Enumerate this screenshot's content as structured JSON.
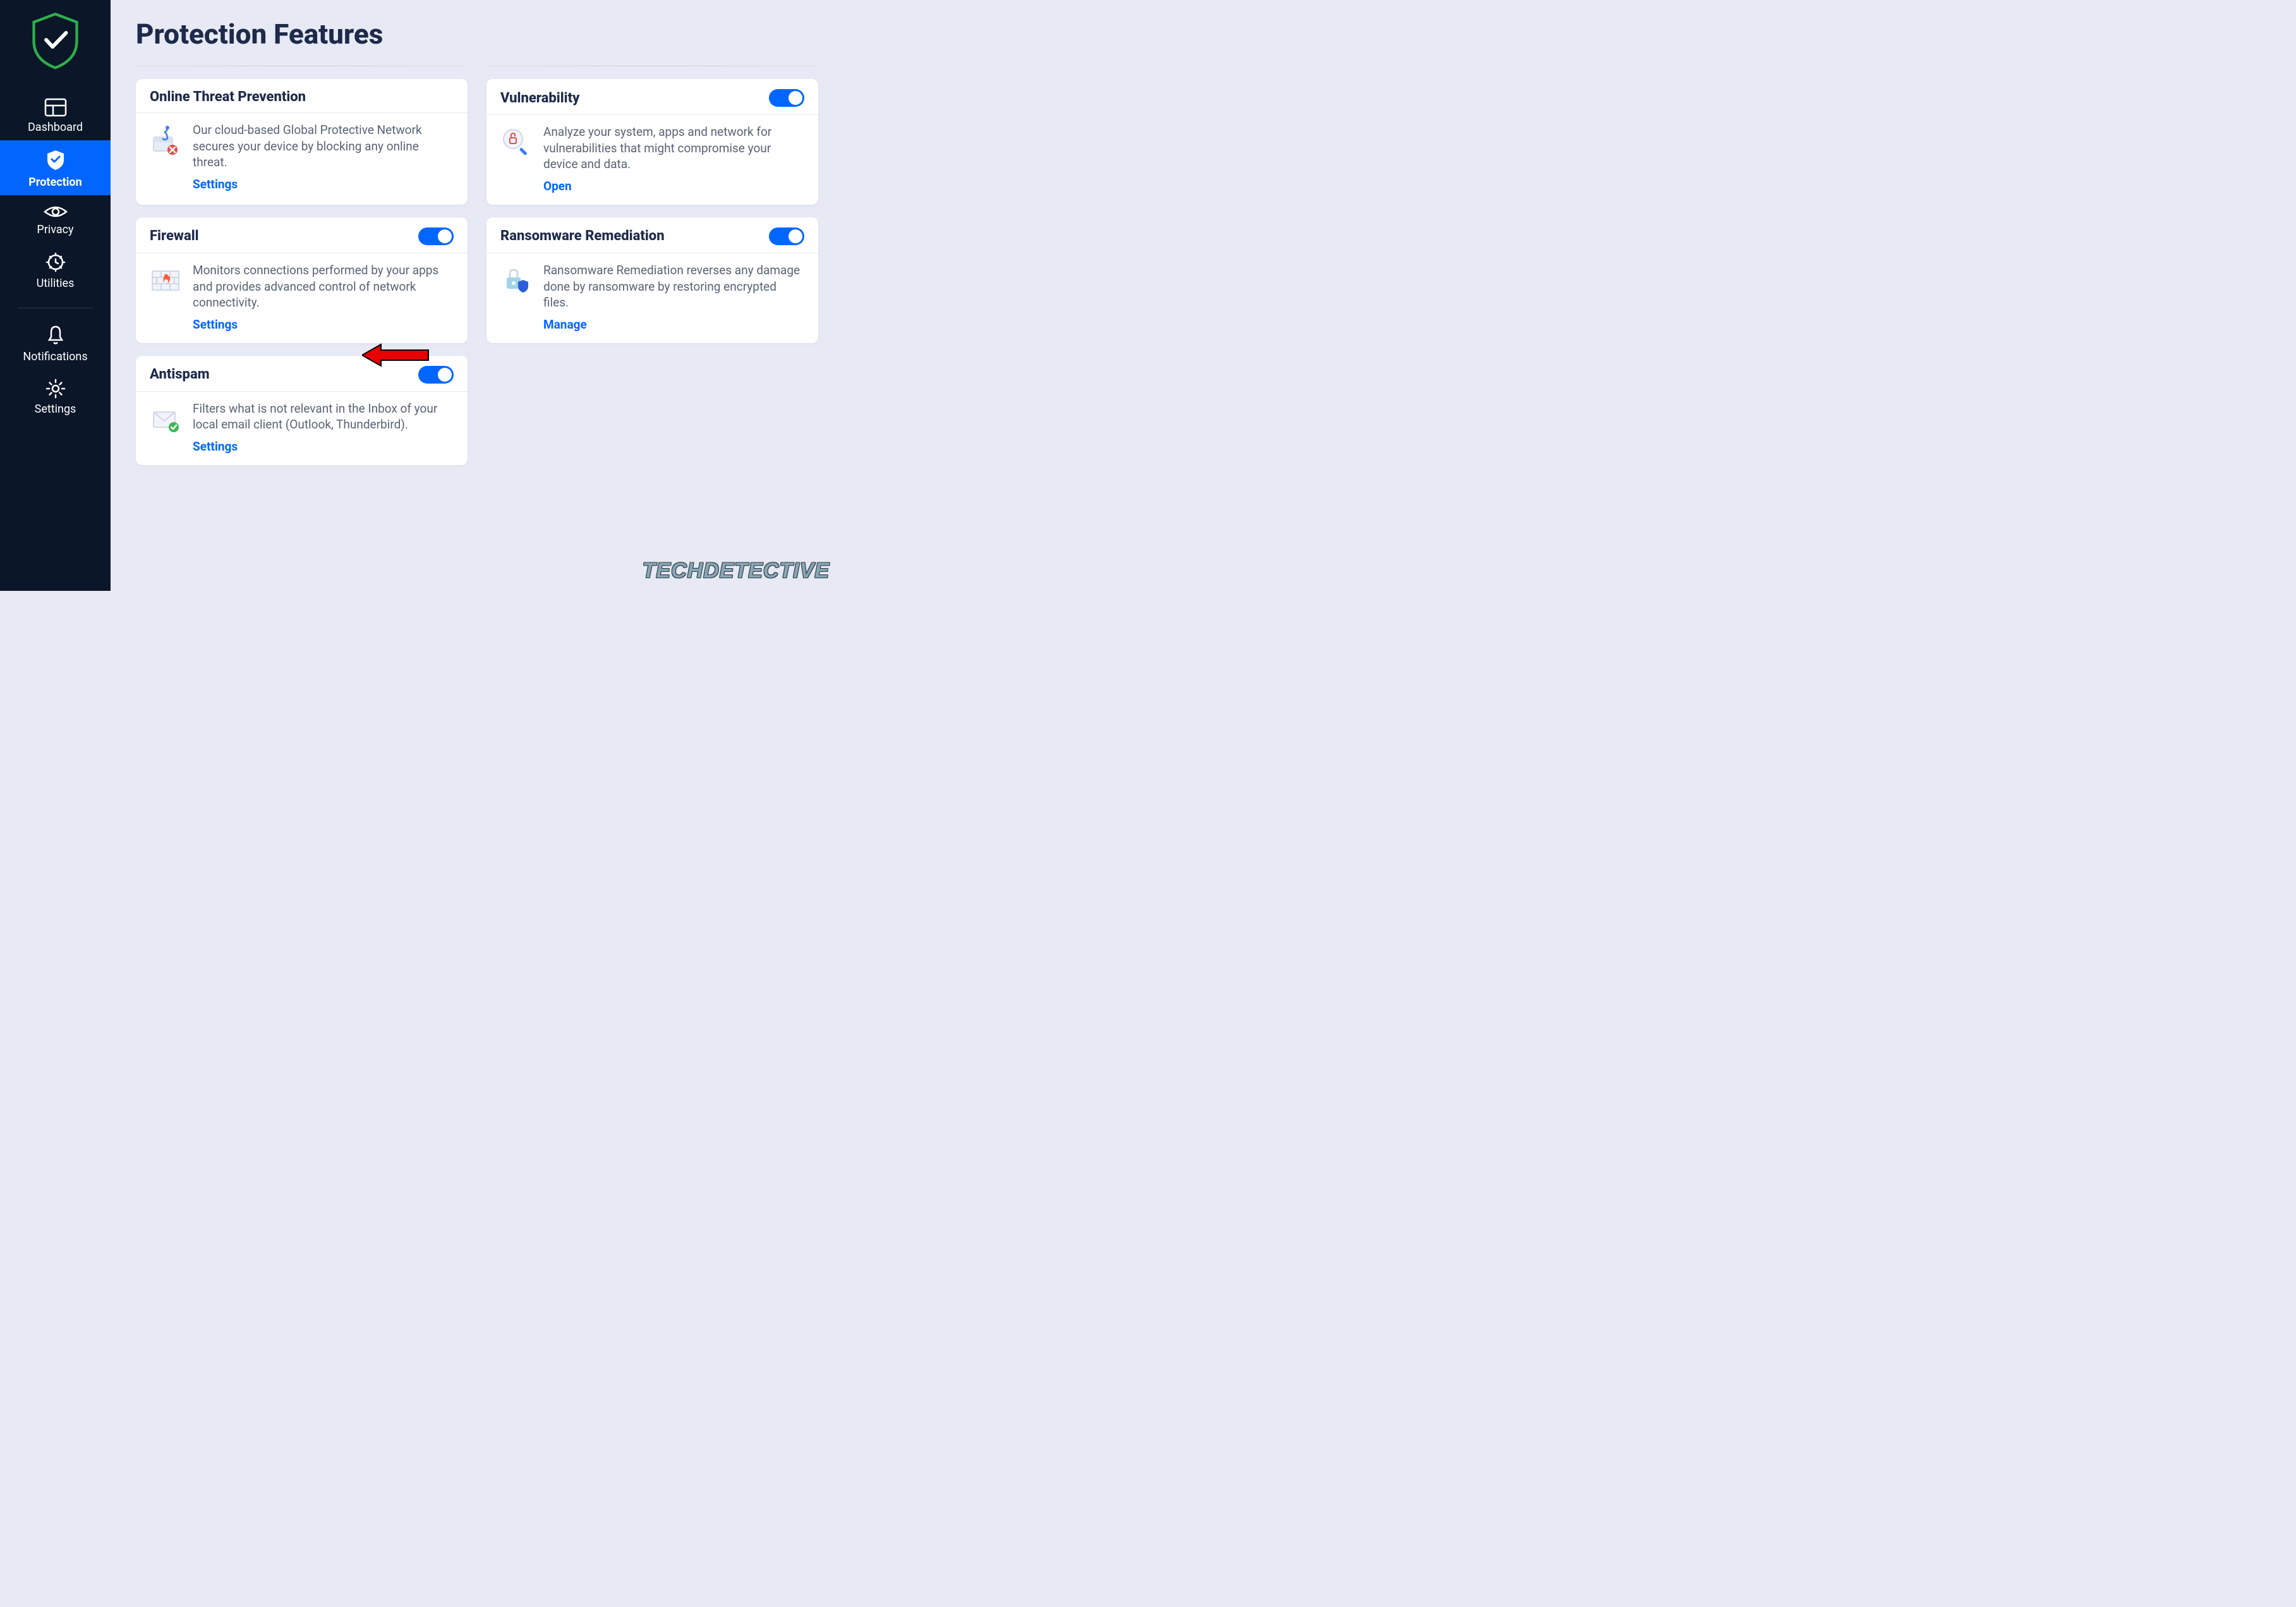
{
  "page_title": "Protection Features",
  "sidebar": {
    "items": [
      {
        "label": "Dashboard"
      },
      {
        "label": "Protection"
      },
      {
        "label": "Privacy"
      },
      {
        "label": "Utilities"
      },
      {
        "label": "Notifications"
      },
      {
        "label": "Settings"
      }
    ],
    "active_index": 1
  },
  "cards": {
    "online_threat": {
      "title": "Online Threat Prevention",
      "desc": "Our cloud-based Global Protective Network secures your device by blocking any online threat.",
      "action": "Settings",
      "toggle": false
    },
    "vulnerability": {
      "title": "Vulnerability",
      "desc": "Analyze your system, apps and network for vulnerabilities that might compromise your device and data.",
      "action": "Open",
      "toggle": true
    },
    "firewall": {
      "title": "Firewall",
      "desc": "Monitors connections performed by your apps and provides advanced control of network connectivity.",
      "action": "Settings",
      "toggle": true
    },
    "ransomware": {
      "title": "Ransomware Remediation",
      "desc": "Ransomware Remediation reverses any damage done by ransomware by restoring encrypted files.",
      "action": "Manage",
      "toggle": true
    },
    "antispam": {
      "title": "Antispam",
      "desc": "Filters what is not relevant in the Inbox of your local email client (Outlook, Thunderbird).",
      "action": "Settings",
      "toggle": true
    }
  },
  "watermark": "TECHDETECTIVE",
  "colors": {
    "accent": "#0066ff",
    "sidebar_bg": "#0b1628",
    "page_bg": "#e7e9f5"
  }
}
